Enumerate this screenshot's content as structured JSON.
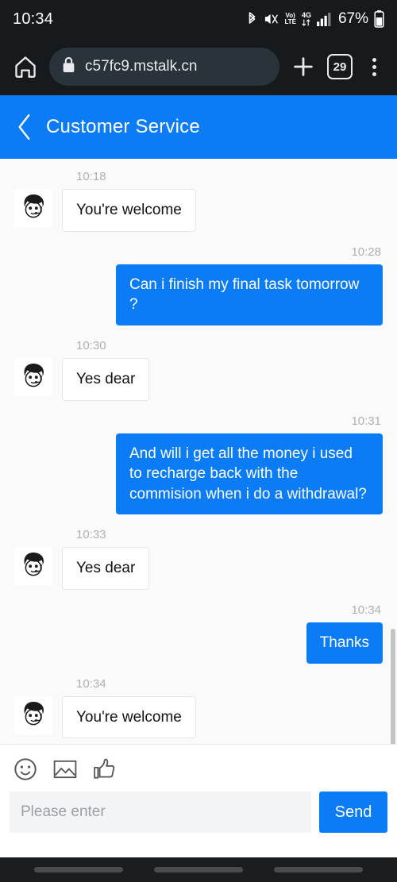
{
  "status_bar": {
    "clock": "10:34",
    "battery_percent": "67%",
    "network_label": "4G",
    "volte_top": "Vo)",
    "volte_bottom": "LTE",
    "icons": [
      "bluetooth-icon",
      "mute-icon",
      "volte-icon",
      "network-4g-icon",
      "signal-bars-icon",
      "battery-icon"
    ]
  },
  "browser_bar": {
    "url": "c57fc9.mstalk.cn",
    "tab_count": "29",
    "icons": [
      "home-icon",
      "lock-icon",
      "plus-icon",
      "tab-counter-icon",
      "overflow-menu-icon"
    ]
  },
  "app_header": {
    "title": "Customer Service",
    "back_icon": "chevron-left-icon",
    "background_color": "#0b7cf5"
  },
  "chat": {
    "messages": [
      {
        "time": "10:18",
        "side": "in",
        "text": "You're welcome"
      },
      {
        "time": "10:28",
        "side": "out",
        "text": "Can i finish my final task tomorrow ?"
      },
      {
        "time": "10:30",
        "side": "in",
        "text": "Yes dear"
      },
      {
        "time": "10:31",
        "side": "out",
        "text": "And will i get all the money i used to recharge back with the commision when i do a withdrawal?"
      },
      {
        "time": "10:33",
        "side": "in",
        "text": "Yes dear"
      },
      {
        "time": "10:34",
        "side": "out",
        "text": "Thanks"
      },
      {
        "time": "10:34",
        "side": "in",
        "text": "You're welcome"
      }
    ]
  },
  "composer": {
    "placeholder": "Please enter",
    "input_value": "",
    "send_label": "Send",
    "tools": [
      "emoji-icon",
      "image-icon",
      "thumbs-up-icon"
    ],
    "accent_color": "#0b7cf5"
  },
  "nav_bar": {
    "pills": 3
  }
}
